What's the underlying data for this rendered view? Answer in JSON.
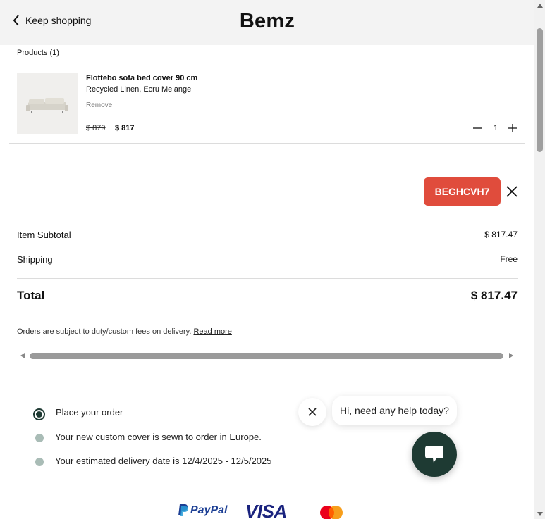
{
  "header": {
    "back_label": "Keep shopping",
    "logo": "Bemz"
  },
  "products": {
    "heading": "Products (1)",
    "items": [
      {
        "name": "Flottebo sofa bed cover 90 cm",
        "variant": "Recycled Linen, Ecru Melange",
        "remove_label": "Remove",
        "old_price": "$ 879",
        "price": "$ 817",
        "quantity": "1"
      }
    ]
  },
  "discount": {
    "code": "BEGHCVH7"
  },
  "summary": {
    "subtotal_label": "Item Subtotal",
    "subtotal_value": "$ 817.47",
    "shipping_label": "Shipping",
    "shipping_value": "Free",
    "total_label": "Total",
    "total_value": "$ 817.47",
    "duty_note": "Orders are subject to duty/custom fees on delivery.",
    "duty_link": "Read more"
  },
  "steps": [
    {
      "text": "Place your order",
      "active": true
    },
    {
      "text": "Your new custom cover is sewn to order in Europe.",
      "active": false
    },
    {
      "text": "Your estimated delivery date is 12/4/2025 - 12/5/2025",
      "active": false
    }
  ],
  "chat": {
    "greeting": "Hi, need any help today?"
  },
  "payment": {
    "paypal": "PayPal",
    "visa": "VISA"
  },
  "colors": {
    "discount_bg": "#e04c3c",
    "chat_button": "#1e3a33",
    "step_active": "#1e3a33",
    "step_inactive": "#a9bcb6",
    "paypal_blue": "#1c3f94",
    "visa_blue": "#1a237e"
  },
  "icons": {
    "back": "chevron-left-icon",
    "minus": "minus-icon",
    "plus": "plus-icon",
    "remove_code": "close-icon",
    "chat": "chat-bubble-icon"
  }
}
